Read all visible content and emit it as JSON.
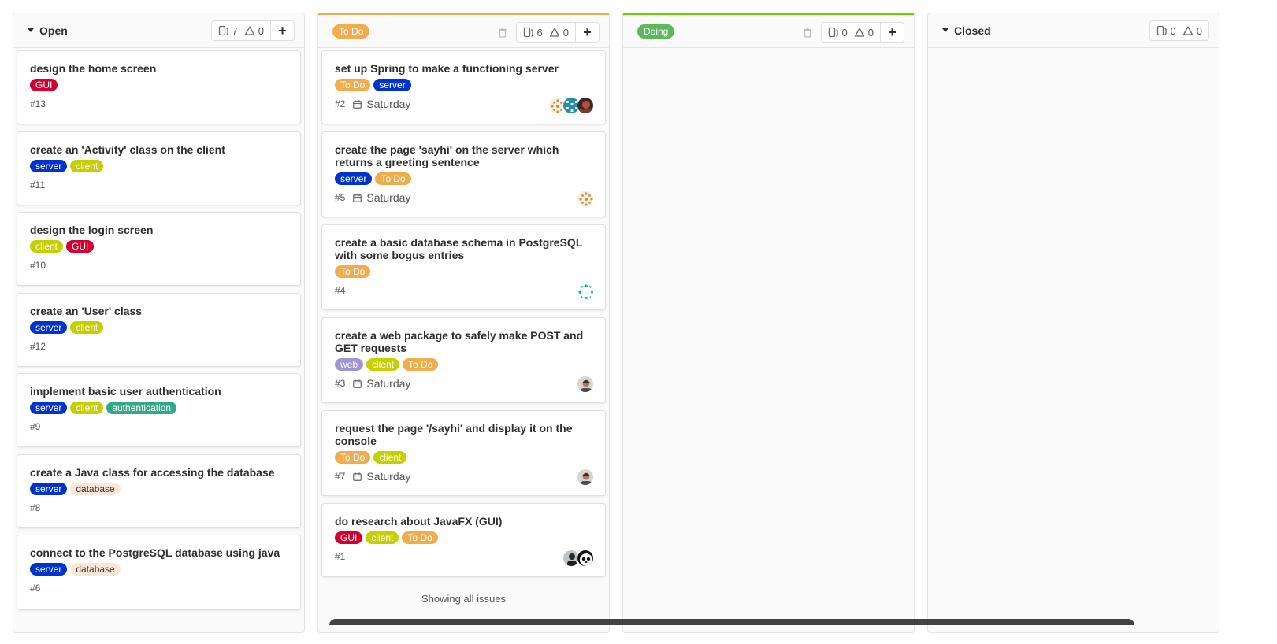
{
  "lists": {
    "open": {
      "title": "Open",
      "issue_count": "7",
      "weight": "0",
      "add_label": "+",
      "cards": [
        {
          "title": "design the home screen",
          "labels": [
            {
              "text": "GUI",
              "color": "#d10030"
            }
          ],
          "number": "#13"
        },
        {
          "title": "create an 'Activity' class on the client",
          "labels": [
            {
              "text": "server",
              "color": "#0033cc"
            },
            {
              "text": "client",
              "color": "#c6cf00"
            }
          ],
          "number": "#11"
        },
        {
          "title": "design the login screen",
          "labels": [
            {
              "text": "client",
              "color": "#c6cf00"
            },
            {
              "text": "GUI",
              "color": "#d10030"
            }
          ],
          "number": "#10"
        },
        {
          "title": "create an 'User' class",
          "labels": [
            {
              "text": "server",
              "color": "#0033cc"
            },
            {
              "text": "client",
              "color": "#c6cf00"
            }
          ],
          "number": "#12"
        },
        {
          "title": "implement basic user authentication",
          "labels": [
            {
              "text": "server",
              "color": "#0033cc"
            },
            {
              "text": "client",
              "color": "#c6cf00"
            },
            {
              "text": "authentication",
              "color": "#34a98a"
            }
          ],
          "number": "#9"
        },
        {
          "title": "create a Java class for accessing the database",
          "labels": [
            {
              "text": "server",
              "color": "#0033cc"
            },
            {
              "text": "database",
              "color": "#fce6d8"
            }
          ],
          "number": "#8"
        },
        {
          "title": "connect to the PostgreSQL database using java",
          "labels": [
            {
              "text": "server",
              "color": "#0033cc"
            },
            {
              "text": "database",
              "color": "#fce6d8"
            }
          ],
          "number": "#6"
        }
      ]
    },
    "todo": {
      "title": "To Do",
      "color": "#f0ad4e",
      "issue_count": "6",
      "weight": "0",
      "add_label": "+",
      "showing": "Showing all issues",
      "cards": [
        {
          "title": "set up Spring to make a functioning server",
          "labels": [
            {
              "text": "To Do",
              "color": "#f0ad4e"
            },
            {
              "text": "server",
              "color": "#0033cc"
            }
          ],
          "number": "#2",
          "due": "Saturday",
          "avatars": [
            "identicon-orange",
            "identicon-teal",
            "photo-red"
          ]
        },
        {
          "title": "create the page 'sayhi' on the server which returns a greeting sentence",
          "labels": [
            {
              "text": "server",
              "color": "#0033cc"
            },
            {
              "text": "To Do",
              "color": "#f0ad4e"
            }
          ],
          "number": "#5",
          "due": "Saturday",
          "avatars": [
            "identicon-orange"
          ]
        },
        {
          "title": "create a basic database schema in PostgreSQL with some bogus entries",
          "labels": [
            {
              "text": "To Do",
              "color": "#f0ad4e"
            }
          ],
          "number": "#4",
          "due": "",
          "avatars": [
            "identicon-green"
          ]
        },
        {
          "title": "create a web package to safely make POST and GET requests",
          "labels": [
            {
              "text": "web",
              "color": "#a295d6"
            },
            {
              "text": "client",
              "color": "#c6cf00"
            },
            {
              "text": "To Do",
              "color": "#f0ad4e"
            }
          ],
          "number": "#3",
          "due": "Saturday",
          "avatars": [
            "photo-man"
          ]
        },
        {
          "title": "request the page '/sayhi' and display it on the console",
          "labels": [
            {
              "text": "To Do",
              "color": "#f0ad4e"
            },
            {
              "text": "client",
              "color": "#c6cf00"
            }
          ],
          "number": "#7",
          "due": "Saturday",
          "avatars": [
            "photo-man"
          ]
        },
        {
          "title": "do research about JavaFX (GUI)",
          "labels": [
            {
              "text": "GUI",
              "color": "#d10030"
            },
            {
              "text": "client",
              "color": "#c6cf00"
            },
            {
              "text": "To Do",
              "color": "#f0ad4e"
            }
          ],
          "number": "#1",
          "due": "",
          "avatars": [
            "photo-dark",
            "photo-panda"
          ]
        }
      ]
    },
    "doing": {
      "title": "Doing",
      "color": "#5cb85c",
      "issue_count": "0",
      "weight": "0",
      "add_label": "+"
    },
    "closed": {
      "title": "Closed",
      "issue_count": "0",
      "weight": "0"
    }
  }
}
